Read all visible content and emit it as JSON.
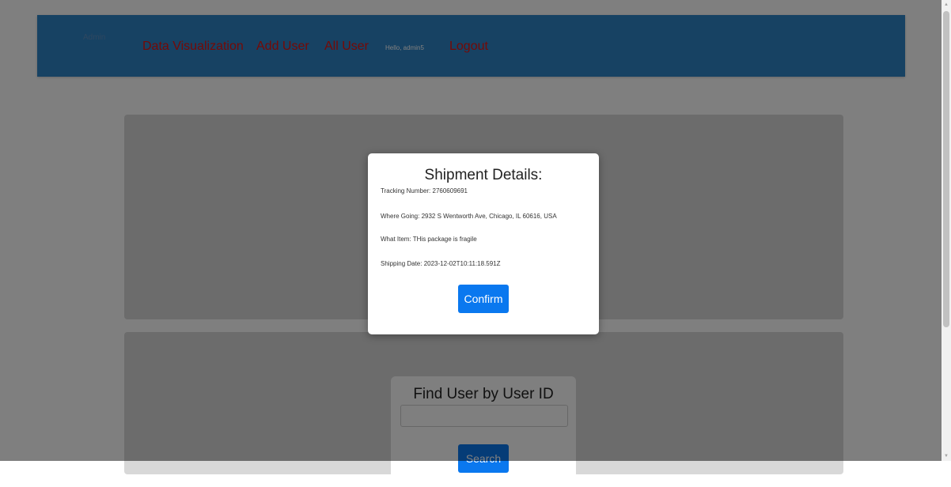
{
  "navbar": {
    "brand": "Admin",
    "links": [
      "Data Visualization",
      "Add User",
      "All User"
    ],
    "greeting": "Hello, admin5",
    "logout": "Logout"
  },
  "find_user": {
    "title": "Find User by User ID",
    "input_value": "",
    "search_label": "Search"
  },
  "modal": {
    "title": "Shipment Details:",
    "tracking": "Tracking Number: 2760609691",
    "where_going": "Where Going: 2932 S Wentworth Ave, Chicago, IL 60616, USA",
    "what_item": "What Item: THis package is fragile",
    "shipping_date": "Shipping Date: 2023-12-02T10:11:18.591Z",
    "confirm_label": "Confirm"
  },
  "scrollbar": {
    "up_icon": "▲",
    "down_icon": "▼"
  },
  "colors": {
    "navbar": "#2f84c6",
    "nav_link": "#e8140f",
    "button": "#0a78ef"
  }
}
